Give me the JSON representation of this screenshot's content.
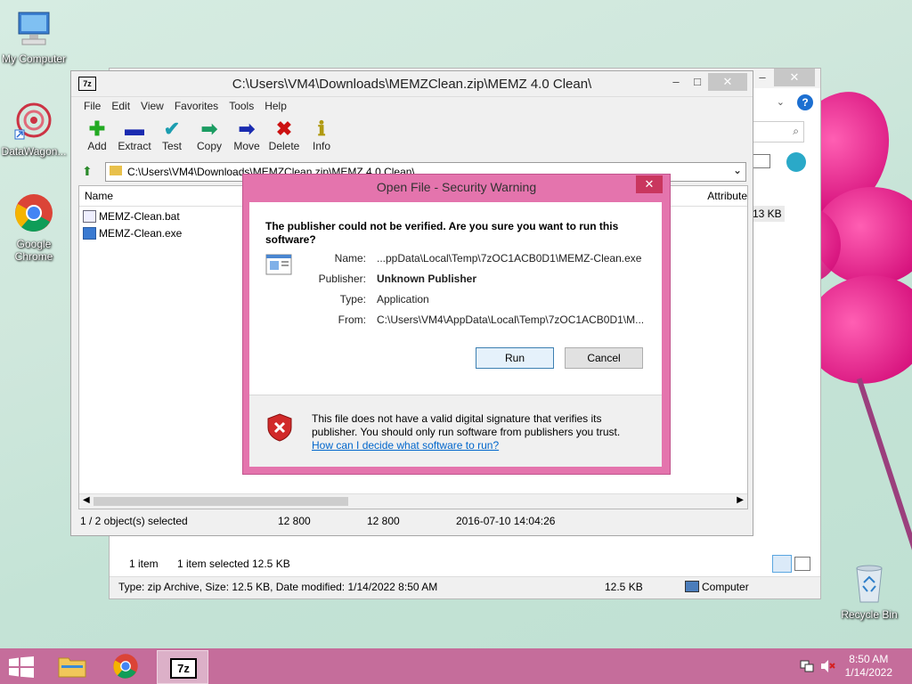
{
  "desktop": {
    "icons": [
      {
        "label": "My Computer"
      },
      {
        "label": "DataWagon..."
      },
      {
        "label": "Google Chrome"
      },
      {
        "label": "Recycle Bin"
      }
    ]
  },
  "explorer": {
    "size_fragment": "13 KB",
    "status": {
      "items": "1 item",
      "selected": "1 item selected",
      "size": "12.5 KB"
    },
    "details": "Type: zip Archive, Size: 12.5 KB, Date modified: 1/14/2022 8:50 AM",
    "details_size": "12.5 KB",
    "location": "Computer"
  },
  "sevenzip": {
    "title": "C:\\Users\\VM4\\Downloads\\MEMZClean.zip\\MEMZ 4.0 Clean\\",
    "menu": [
      "File",
      "Edit",
      "View",
      "Favorites",
      "Tools",
      "Help"
    ],
    "toolbar": [
      {
        "label": "Add",
        "icon": "plus-icon",
        "color": "#22aa22",
        "glyph": "✚"
      },
      {
        "label": "Extract",
        "icon": "minus-icon",
        "color": "#1a2bb0",
        "glyph": "▬"
      },
      {
        "label": "Test",
        "icon": "check-icon",
        "color": "#1b9db0",
        "glyph": "✔"
      },
      {
        "label": "Copy",
        "icon": "copy-arrow-icon",
        "color": "#1b9c62",
        "glyph": "➡"
      },
      {
        "label": "Move",
        "icon": "move-arrow-icon",
        "color": "#1a2bb0",
        "glyph": "➡"
      },
      {
        "label": "Delete",
        "icon": "delete-x-icon",
        "color": "#cc1111",
        "glyph": "✖"
      },
      {
        "label": "Info",
        "icon": "info-icon",
        "color": "#b09a11",
        "glyph": "ℹ"
      }
    ],
    "address": "C:\\Users\\VM4\\Downloads\\MEMZClean.zip\\MEMZ 4.0 Clean\\",
    "columns": {
      "name": "Name",
      "attributes": "Attribute"
    },
    "files": [
      {
        "name": "MEMZ-Clean.bat"
      },
      {
        "name": "MEMZ-Clean.exe"
      }
    ],
    "status": {
      "selected": "1 / 2 object(s) selected",
      "size": "12 800",
      "packed": "12 800",
      "modified": "2016-07-10 14:04:26"
    }
  },
  "dialog": {
    "title": "Open File - Security Warning",
    "question": "The publisher could not be verified.  Are you sure you want to run this software?",
    "fields": [
      {
        "label": "Name:",
        "value": "...ppData\\Local\\Temp\\7zOC1ACB0D1\\MEMZ-Clean.exe",
        "bold": false
      },
      {
        "label": "Publisher:",
        "value": "Unknown Publisher",
        "bold": true
      },
      {
        "label": "Type:",
        "value": "Application",
        "bold": false
      },
      {
        "label": "From:",
        "value": "C:\\Users\\VM4\\AppData\\Local\\Temp\\7zOC1ACB0D1\\M...",
        "bold": false
      }
    ],
    "run_label": "Run",
    "cancel_label": "Cancel",
    "warning": "This file does not have a valid digital signature that verifies its publisher.  You should only run software from publishers you trust.",
    "link": "How can I decide what software to run?"
  },
  "taskbar": {
    "time": "8:50 AM",
    "date": "1/14/2022"
  }
}
